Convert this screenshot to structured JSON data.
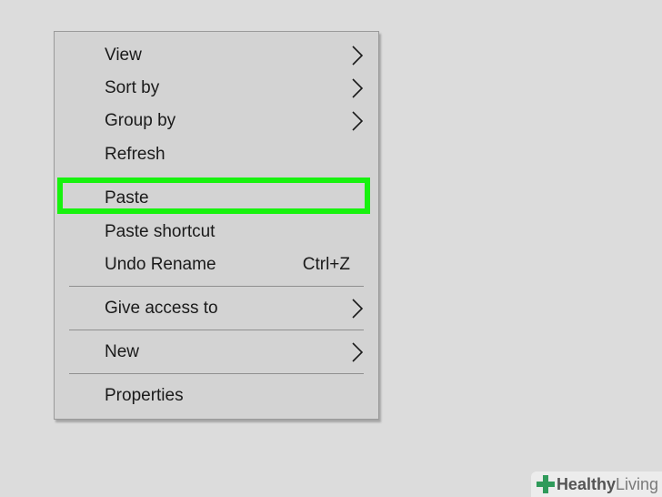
{
  "context_menu": {
    "items": [
      {
        "label": "View",
        "submenu": true
      },
      {
        "label": "Sort by",
        "submenu": true
      },
      {
        "label": "Group by",
        "submenu": true
      },
      {
        "label": "Refresh"
      },
      {
        "label": "Paste",
        "highlighted": true
      },
      {
        "label": "Paste shortcut"
      },
      {
        "label": "Undo Rename",
        "shortcut": "Ctrl+Z"
      },
      {
        "label": "Give access to",
        "submenu": true
      },
      {
        "label": "New",
        "submenu": true
      },
      {
        "label": "Properties"
      }
    ]
  },
  "colors": {
    "background": "#dcdcdc",
    "menu_background": "#d3d3d3",
    "highlight": "#17f20e"
  },
  "watermark": {
    "part1": "Healthy",
    "part2": "Living"
  }
}
